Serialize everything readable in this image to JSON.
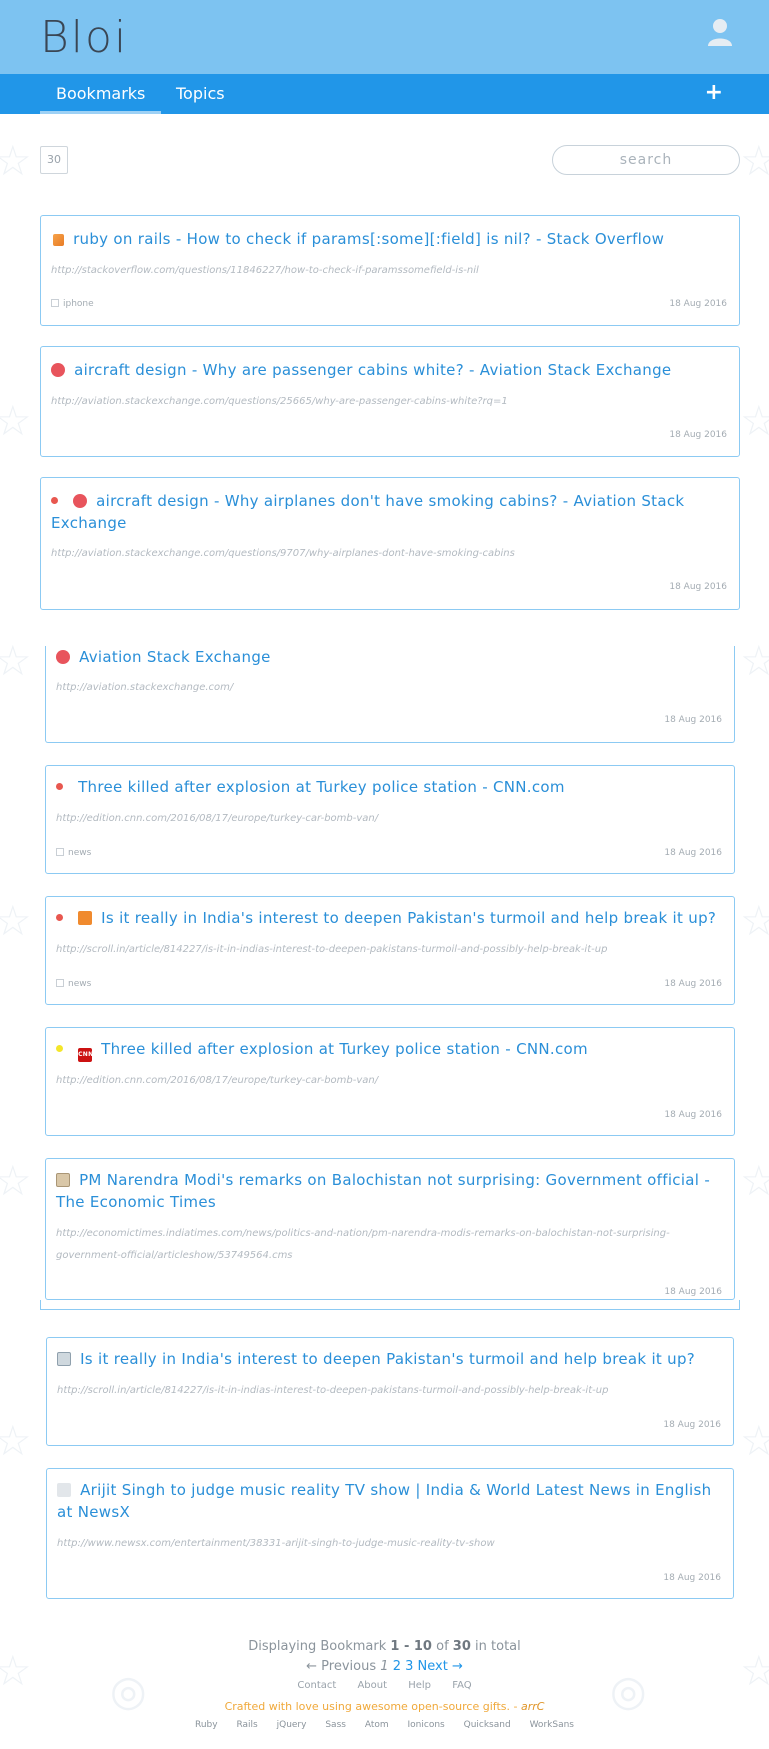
{
  "app": {
    "logo": "Bloi"
  },
  "nav": {
    "tabs": [
      "Bookmarks",
      "Topics"
    ],
    "add_label": "+"
  },
  "toolbar": {
    "count": "30",
    "search_placeholder": "search"
  },
  "bookmarks": [
    {
      "favicon": "stackoverflow-icon",
      "dot": "",
      "title": "ruby on rails - How to check if params[:some][:field] is nil? - Stack Overflow",
      "url": "http://stackoverflow.com/questions/11846227/how-to-check-if-paramssomefield-is-nil",
      "tag": "iphone",
      "date": "18 Aug 2016"
    },
    {
      "favicon": "aviation-icon",
      "dot": "",
      "title": "aircraft design - Why are passenger cabins white? - Aviation Stack Exchange",
      "url": "http://aviation.stackexchange.com/questions/25665/why-are-passenger-cabins-white?rq=1",
      "tag": "",
      "date": "18 Aug 2016"
    },
    {
      "favicon": "aviation-icon",
      "dot": "#e8574f",
      "title": "aircraft design - Why airplanes don't have smoking cabins? - Aviation Stack Exchange",
      "url": "http://aviation.stackexchange.com/questions/9707/why-airplanes-dont-have-smoking-cabins",
      "tag": "",
      "date": "18 Aug 2016"
    },
    {
      "favicon": "aviation-icon",
      "dot": "",
      "title": "Aviation Stack Exchange",
      "url": "http://aviation.stackexchange.com/",
      "tag": "",
      "date": "18 Aug 2016"
    },
    {
      "favicon": "",
      "dot": "#e8574f",
      "title": "Three killed after explosion at Turkey police station - CNN.com",
      "url": "http://edition.cnn.com/2016/08/17/europe/turkey-car-bomb-van/",
      "tag": "news",
      "date": "18 Aug 2016"
    },
    {
      "favicon": "scroll-icon",
      "dot": "#e8574f",
      "title": "Is it really in India's interest to deepen Pakistan's turmoil and help break it up?",
      "url": "http://scroll.in/article/814227/is-it-in-indias-interest-to-deepen-pakistans-turmoil-and-possibly-help-break-it-up",
      "tag": "news",
      "date": "18 Aug 2016"
    },
    {
      "favicon": "cnn-icon",
      "dot": "#f4e62a",
      "title": "Three killed after explosion at Turkey police station - CNN.com",
      "url": "http://edition.cnn.com/2016/08/17/europe/turkey-car-bomb-van/",
      "tag": "",
      "date": "18 Aug 2016"
    },
    {
      "favicon": "economictimes-icon",
      "dot": "",
      "title": "PM Narendra Modi's remarks on Balochistan not surprising: Government official - The Economic Times",
      "url": "http://economictimes.indiatimes.com/news/politics-and-nation/pm-narendra-modis-remarks-on-balochistan-not-surprising-government-official/articleshow/53749564.cms",
      "tag": "",
      "date": "18 Aug 2016"
    },
    {
      "favicon": "image-icon",
      "dot": "",
      "title": "Is it really in India's interest to deepen Pakistan's turmoil and help break it up?",
      "url": "http://scroll.in/article/814227/is-it-in-indias-interest-to-deepen-pakistans-turmoil-and-possibly-help-break-it-up",
      "tag": "",
      "date": "18 Aug 2016"
    },
    {
      "favicon": "newsx-icon",
      "dot": "",
      "title": "Arijit Singh to judge music reality TV show | India & World Latest News in English at NewsX",
      "url": "http://www.newsx.com/entertainment/38331-arijit-singh-to-judge-music-reality-tv-show",
      "tag": "",
      "date": "18 Aug 2016"
    }
  ],
  "pagination": {
    "display_prefix": "Displaying Bookmark",
    "range": "1 - 10",
    "of": "of",
    "total": "30",
    "suffix": "in total",
    "previous": "← Previous",
    "pages": [
      "1",
      "2",
      "3"
    ],
    "next": "Next →"
  },
  "footer": {
    "links": [
      "Contact",
      "About",
      "Help",
      "FAQ"
    ],
    "crafted": "Crafted with love using awesome open-source gifts. - ",
    "author": "arrC",
    "tech": [
      "Ruby",
      "Rails",
      "jQuery",
      "Sass",
      "Atom",
      "Ionicons",
      "Quicksand",
      "WorkSans"
    ]
  },
  "colors": {
    "header": "#7dc3f1",
    "nav": "#2196e8",
    "accent": "#2a8fd8",
    "card_border": "#8ccaf3"
  }
}
